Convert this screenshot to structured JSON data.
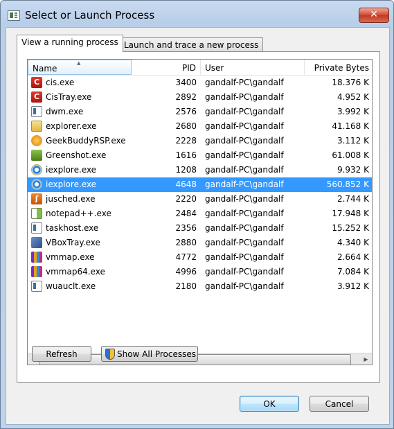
{
  "window": {
    "title": "Select or Launch Process",
    "close_glyph": "✕"
  },
  "tabs": [
    {
      "label": "View a running process",
      "active": true
    },
    {
      "label": "Launch and trace a new process",
      "active": false
    }
  ],
  "table": {
    "columns": [
      "Name",
      "PID",
      "User",
      "Private Bytes"
    ],
    "sort_indicator": "▲",
    "rows": [
      {
        "icon": "red-c-icon",
        "name": "cis.exe",
        "pid": "3400",
        "user": "gandalf-PC\\gandalf",
        "private_bytes": "18.376 K",
        "selected": false
      },
      {
        "icon": "red-c-icon",
        "name": "CisTray.exe",
        "pid": "2892",
        "user": "gandalf-PC\\gandalf",
        "private_bytes": "4.952 K",
        "selected": false
      },
      {
        "icon": "window-icon",
        "name": "dwm.exe",
        "pid": "2576",
        "user": "gandalf-PC\\gandalf",
        "private_bytes": "3.992 K",
        "selected": false
      },
      {
        "icon": "folder-icon",
        "name": "explorer.exe",
        "pid": "2680",
        "user": "gandalf-PC\\gandalf",
        "private_bytes": "41.168 K",
        "selected": false
      },
      {
        "icon": "geekbuddy-icon",
        "name": "GeekBuddyRSP.exe",
        "pid": "2228",
        "user": "gandalf-PC\\gandalf",
        "private_bytes": "3.112 K",
        "selected": false
      },
      {
        "icon": "greenshot-icon",
        "name": "Greenshot.exe",
        "pid": "1616",
        "user": "gandalf-PC\\gandalf",
        "private_bytes": "61.008 K",
        "selected": false
      },
      {
        "icon": "internet-explorer-icon",
        "name": "iexplore.exe",
        "pid": "1208",
        "user": "gandalf-PC\\gandalf",
        "private_bytes": "9.932 K",
        "selected": false
      },
      {
        "icon": "internet-explorer-icon",
        "name": "iexplore.exe",
        "pid": "4648",
        "user": "gandalf-PC\\gandalf",
        "private_bytes": "560.852 K",
        "selected": true
      },
      {
        "icon": "java-icon",
        "name": "jusched.exe",
        "pid": "2220",
        "user": "gandalf-PC\\gandalf",
        "private_bytes": "2.744 K",
        "selected": false
      },
      {
        "icon": "notepad-plus-plus-icon",
        "name": "notepad++.exe",
        "pid": "2484",
        "user": "gandalf-PC\\gandalf",
        "private_bytes": "17.948 K",
        "selected": false
      },
      {
        "icon": "window-icon",
        "name": "taskhost.exe",
        "pid": "2356",
        "user": "gandalf-PC\\gandalf",
        "private_bytes": "15.252 K",
        "selected": false
      },
      {
        "icon": "virtualbox-icon",
        "name": "VBoxTray.exe",
        "pid": "2880",
        "user": "gandalf-PC\\gandalf",
        "private_bytes": "4.340 K",
        "selected": false
      },
      {
        "icon": "vmmap-icon",
        "name": "vmmap.exe",
        "pid": "4772",
        "user": "gandalf-PC\\gandalf",
        "private_bytes": "2.664 K",
        "selected": false
      },
      {
        "icon": "vmmap-icon",
        "name": "vmmap64.exe",
        "pid": "4996",
        "user": "gandalf-PC\\gandalf",
        "private_bytes": "7.084 K",
        "selected": false
      },
      {
        "icon": "window-icon",
        "name": "wuauclt.exe",
        "pid": "2180",
        "user": "gandalf-PC\\gandalf",
        "private_bytes": "3.912 K",
        "selected": false
      }
    ]
  },
  "scrollbar": {
    "left_glyph": "◀",
    "right_glyph": "▶",
    "thumb_grip": "III"
  },
  "buttons": {
    "refresh": "Refresh",
    "show_all": "Show All Processes",
    "ok": "OK",
    "cancel": "Cancel"
  },
  "colors": {
    "selection": "#3399ff",
    "close_button": "#c13a22"
  }
}
